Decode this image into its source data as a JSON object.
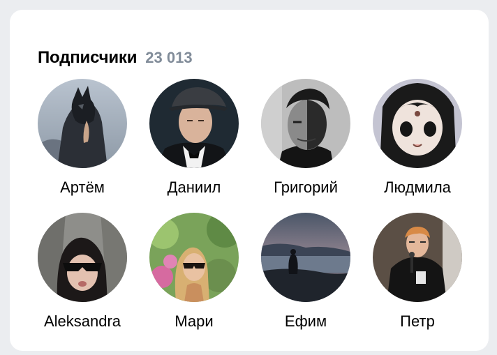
{
  "section": {
    "title": "Подписчики",
    "count": "23 013"
  },
  "followers": [
    {
      "name": "Артём",
      "avatar": "hooded-wolf-mask-person"
    },
    {
      "name": "Даниил",
      "avatar": "man-in-flat-cap"
    },
    {
      "name": "Григорий",
      "avatar": "bw-portrait-man-shadow"
    },
    {
      "name": "Людмила",
      "avatar": "anime-girl-drawing"
    },
    {
      "name": "Aleksandra",
      "avatar": "woman-sunglasses-stone-wall"
    },
    {
      "name": "Мари",
      "avatar": "blonde-woman-garden"
    },
    {
      "name": "Ефим",
      "avatar": "silhouette-sea-dusk"
    },
    {
      "name": "Петр",
      "avatar": "man-with-microphone"
    }
  ]
}
